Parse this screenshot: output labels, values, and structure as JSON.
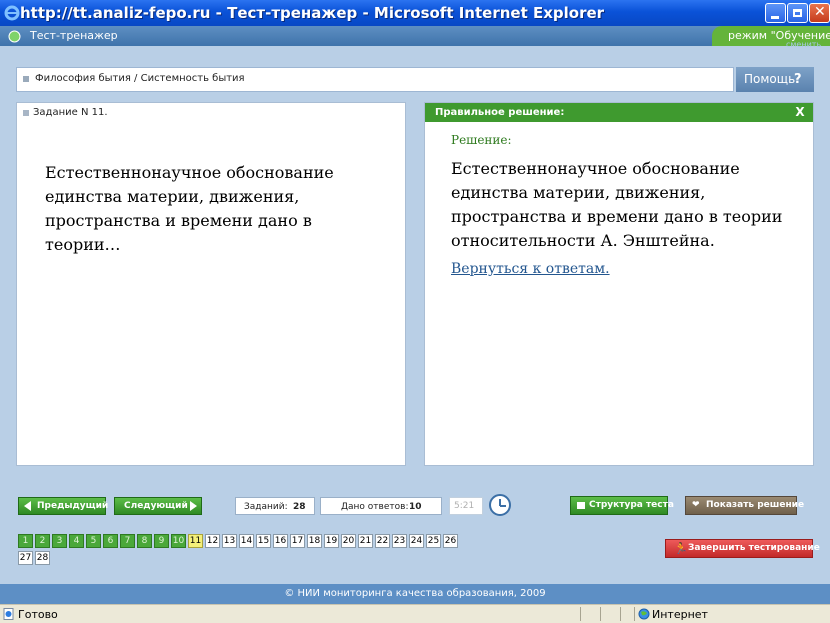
{
  "window": {
    "title": "http://tt.analiz-fepo.ru - Тест-тренажер - Microsoft Internet Explorer"
  },
  "app": {
    "name": "Тест-тренажер",
    "mode": "режим \"Обучение\"",
    "mode_sub": "сменить"
  },
  "breadcrumb": "Философия бытия / Системность бытия",
  "help_label": "Помощь",
  "task": {
    "label": "Задание N 11.",
    "question": "Естественнонаучное обоснование единства материи, движения, пространства и времени дано в теории…"
  },
  "solution": {
    "header": "Правильное решение:",
    "close": "X",
    "label": "Решение:",
    "text": "Естественнонаучное обоснование единства материи, движения, пространства и времени дано в теории  относительности А. Энштейна.",
    "back_link": "Вернуться к ответам."
  },
  "toolbar": {
    "prev": "Предыдущий",
    "next": "Следующий",
    "tasks_label": "Заданий:",
    "tasks_count": "28",
    "answered_label": "Дано ответов:",
    "answered_count": "10",
    "timer": "5:21",
    "structure": "Структура теста",
    "show_solution": "Показать решение",
    "finish": "Завершить тестирование"
  },
  "questions": {
    "items": [
      "1",
      "2",
      "3",
      "4",
      "5",
      "6",
      "7",
      "8",
      "9",
      "10",
      "11",
      "12",
      "13",
      "14",
      "15",
      "16",
      "17",
      "18",
      "19",
      "20",
      "21",
      "22",
      "23",
      "24",
      "25",
      "26",
      "27",
      "28"
    ],
    "done": [
      1,
      2,
      3,
      4,
      5,
      6,
      7,
      8,
      9,
      10
    ],
    "current": 11
  },
  "footer": "© НИИ мониторинга качества образования, 2009",
  "status": {
    "ready": "Готово",
    "zone": "Интернет"
  },
  "colors": {
    "titlebar": "#0a52d8",
    "accent_green": "#3f9a2f",
    "link": "#23568f",
    "finish_red": "#c22a2a"
  }
}
